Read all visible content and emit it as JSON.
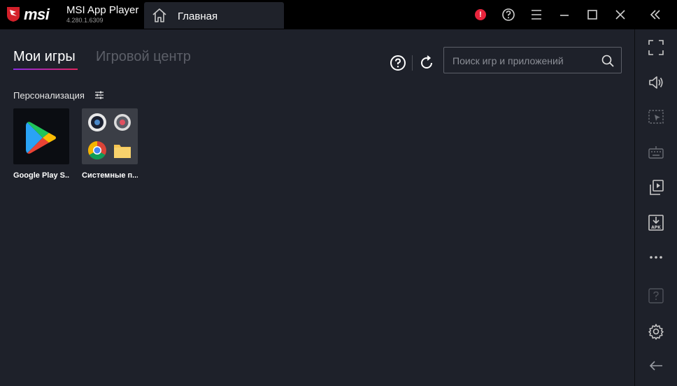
{
  "titlebar": {
    "brand": "msi",
    "app_name": "MSI App Player",
    "version": "4.280.1.6309",
    "tab_label": "Главная",
    "alert_label": "!"
  },
  "main": {
    "tabs": [
      {
        "label": "Мои игры",
        "active": true
      },
      {
        "label": "Игровой центр",
        "active": false
      }
    ],
    "search": {
      "placeholder": "Поиск игр и приложений",
      "value": ""
    },
    "section_title": "Персонализация",
    "apps": [
      {
        "label": "Google Play S...",
        "icon": "google-play-icon"
      },
      {
        "label": "Системные п...",
        "icon": "system-apps-folder-icon"
      }
    ]
  },
  "sidebar": {
    "items": [
      "fullscreen-icon",
      "volume-icon",
      "selection-icon",
      "keyboard-icon",
      "media-manager-icon",
      "apk-install-icon",
      "more-icon",
      "help-icon",
      "settings-icon",
      "back-arrow-icon"
    ]
  },
  "colors": {
    "accent_start": "#8a2be2",
    "accent_end": "#e0245e",
    "alert": "#e8243c",
    "background": "#1e212a"
  }
}
